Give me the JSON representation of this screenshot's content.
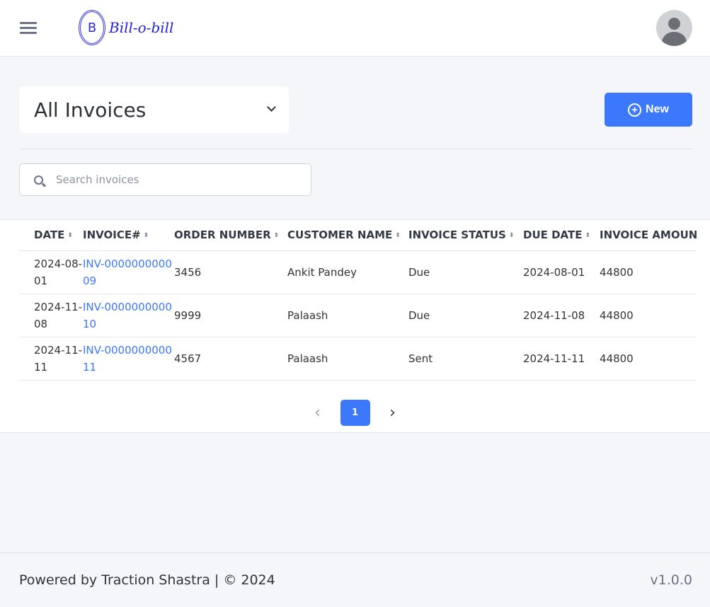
{
  "header": {
    "logo_letter": "B",
    "logo_text": "Bill-o-bill"
  },
  "page": {
    "view_selector": "All Invoices",
    "new_button": "New",
    "search_placeholder": "Search invoices"
  },
  "table": {
    "columns": [
      "DATE",
      "INVOICE#",
      "ORDER NUMBER",
      "CUSTOMER NAME",
      "INVOICE STATUS",
      "DUE DATE",
      "INVOICE AMOUN"
    ],
    "rows": [
      {
        "date": "2024-08-01",
        "invoice": "INV-000000000009",
        "order": "3456",
        "customer": "Ankit Pandey",
        "status": "Due",
        "due": "2024-08-01",
        "amount": "44800"
      },
      {
        "date": "2024-11-08",
        "invoice": "INV-000000000010",
        "order": "9999",
        "customer": "Palaash",
        "status": "Due",
        "due": "2024-11-08",
        "amount": "44800"
      },
      {
        "date": "2024-11-11",
        "invoice": "INV-000000000011",
        "order": "4567",
        "customer": "Palaash",
        "status": "Sent",
        "due": "2024-11-11",
        "amount": "44800"
      }
    ]
  },
  "pagination": {
    "current": "1",
    "prev": "‹",
    "next": "›"
  },
  "footer": {
    "powered": "Powered by Traction Shastra | © 2024",
    "version": "v1.0.0"
  },
  "colors": {
    "accent": "#3b78fb",
    "logo": "#2222dd"
  }
}
